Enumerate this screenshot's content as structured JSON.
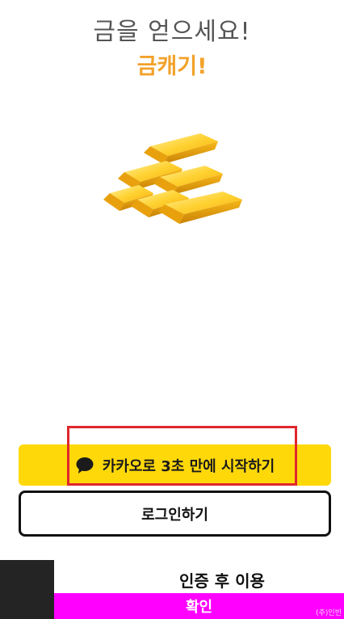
{
  "header": {
    "title": "금을 얻으세요!",
    "subtitle": "금캐기!"
  },
  "hero": {
    "image": "gold-bars-icon"
  },
  "kakao_button": {
    "icon": "speech-bubble-icon",
    "label": "카카오로 3초 만에 시작하기",
    "color": "#ffd80a"
  },
  "login_button": {
    "label": "로그인하기"
  },
  "auth_overlay": {
    "text": "인증 후 이용",
    "confirm_label": "확인",
    "confirm_color": "#ff00ff",
    "company": "(주)인빈"
  },
  "colors": {
    "subtitle": "#f2a22b",
    "highlight": "#e0262d"
  }
}
